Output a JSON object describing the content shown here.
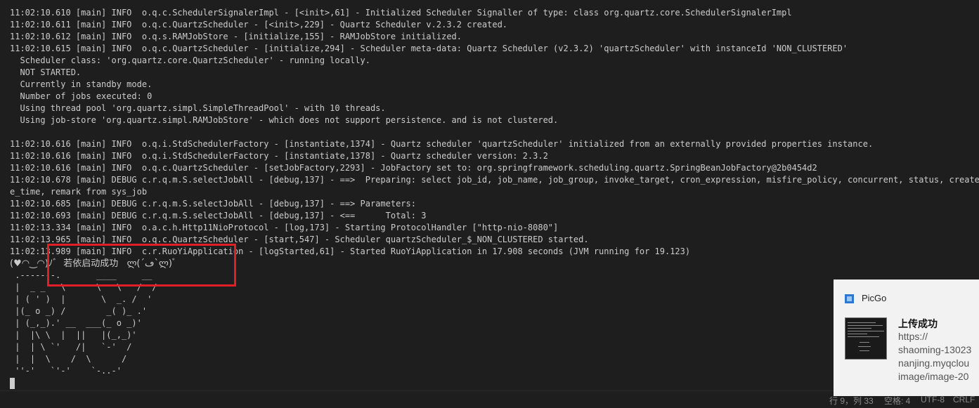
{
  "terminal": {
    "lines": [
      "11:02:10.610 [main] INFO  o.q.c.SchedulerSignalerImpl - [<init>,61] - Initialized Scheduler Signaller of type: class org.quartz.core.SchedulerSignalerImpl",
      "11:02:10.611 [main] INFO  o.q.c.QuartzScheduler - [<init>,229] - Quartz Scheduler v.2.3.2 created.",
      "11:02:10.612 [main] INFO  o.q.s.RAMJobStore - [initialize,155] - RAMJobStore initialized.",
      "11:02:10.615 [main] INFO  o.q.c.QuartzScheduler - [initialize,294] - Scheduler meta-data: Quartz Scheduler (v2.3.2) 'quartzScheduler' with instanceId 'NON_CLUSTERED'",
      "  Scheduler class: 'org.quartz.core.QuartzScheduler' - running locally.",
      "  NOT STARTED.",
      "  Currently in standby mode.",
      "  Number of jobs executed: 0",
      "  Using thread pool 'org.quartz.simpl.SimpleThreadPool' - with 10 threads.",
      "  Using job-store 'org.quartz.simpl.RAMJobStore' - which does not support persistence. and is not clustered.",
      "",
      "11:02:10.616 [main] INFO  o.q.i.StdSchedulerFactory - [instantiate,1374] - Quartz scheduler 'quartzScheduler' initialized from an externally provided properties instance.",
      "11:02:10.616 [main] INFO  o.q.i.StdSchedulerFactory - [instantiate,1378] - Quartz scheduler version: 2.3.2",
      "11:02:10.616 [main] INFO  o.q.c.QuartzScheduler - [setJobFactory,2293] - JobFactory set to: org.springframework.scheduling.quartz.SpringBeanJobFactory@2b0454d2",
      "11:02:10.678 [main] DEBUG c.r.q.m.S.selectJobAll - [debug,137] - ==>  Preparing: select job_id, job_name, job_group, invoke_target, cron_expression, misfire_policy, concurrent, status, create_by, c",
      "e_time, remark from sys_job",
      "11:02:10.685 [main] DEBUG c.r.q.m.S.selectJobAll - [debug,137] - ==> Parameters:",
      "11:02:10.693 [main] DEBUG c.r.q.m.S.selectJobAll - [debug,137] - <==      Total: 3",
      "11:02:13.334 [main] INFO  o.a.c.h.Http11NioProtocol - [log,173] - Starting ProtocolHandler [\"http-nio-8080\"]",
      "11:02:13.965 [main] INFO  o.q.c.QuartzScheduler - [start,547] - Scheduler quartzScheduler_$_NON_CLUSTERED started.",
      "11:02:13.989 [main] INFO  c.r.RuoYiApplication - [logStarted,61] - Started RuoYiApplication in 17.908 seconds (JVM running for 19.123)"
    ],
    "banner_success": "(♥◠‿◠)ﾉﾞ  若依启动成功   ლ(´ڡ`ლ)ﾞ",
    "ascii_art": [
      " .-------.       ____     __",
      " |  _ _   \\      \\   \\   /  /",
      " | ( ' )  |       \\  _. /  '",
      " |(_ o _) /        _( )_ .'",
      " | (_,_).' __  ___(_ o _)'",
      " |  |\\ \\  |  ||   |(_,_)'",
      " |  | \\ `'   /|   `-'  /",
      " |  |  \\    /  \\      /",
      " ''-'   `'-'    `-..-'"
    ]
  },
  "statusbar": {
    "position": "行 9，列 33",
    "indent": "空格: 4",
    "encoding": "UTF-8",
    "eol": "CRLF"
  },
  "toast": {
    "app_name": "PicGo",
    "title": "上传成功",
    "body_lines": [
      "https://",
      "shaoming-13023",
      "nanjing.myqclou",
      "image/image-20"
    ]
  },
  "colors": {
    "terminal_bg": "#1e1e1e",
    "terminal_text": "#cccccc",
    "highlight_border": "#e21f26",
    "toast_bg": "#f2f2f2"
  }
}
